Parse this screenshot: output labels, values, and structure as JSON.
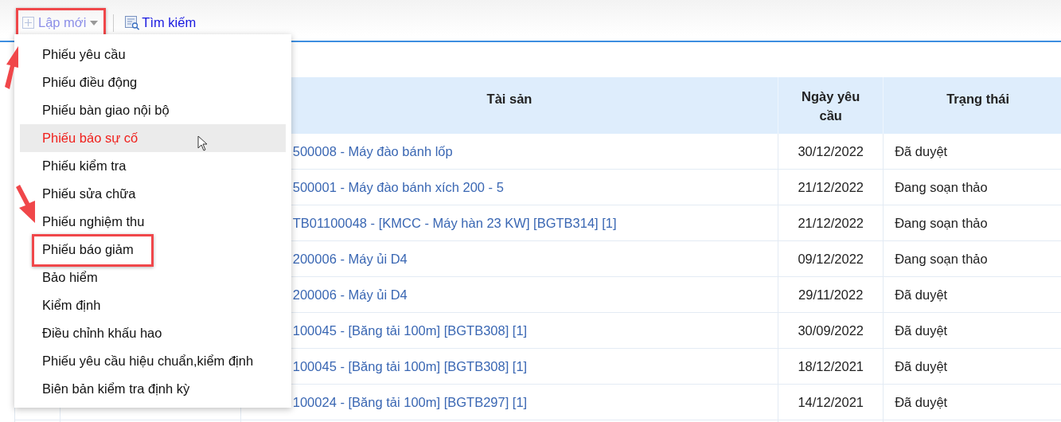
{
  "toolbar": {
    "new_button": {
      "label": "Lập mới",
      "callout": true
    },
    "search_button": {
      "label": "Tìm kiếm"
    }
  },
  "menu": [
    {
      "label": "Phiếu yêu cầu",
      "selected": false,
      "callout": false
    },
    {
      "label": "Phiếu điều động",
      "selected": false,
      "callout": false
    },
    {
      "label": "Phiếu bàn giao nội bộ",
      "selected": false,
      "callout": false
    },
    {
      "label": "Phiếu báo sự cố",
      "selected": true,
      "callout": false
    },
    {
      "label": "Phiếu kiểm tra",
      "selected": false,
      "callout": false
    },
    {
      "label": "Phiếu sửa chữa",
      "selected": false,
      "callout": false
    },
    {
      "label": "Phiếu nghiệm thu",
      "selected": false,
      "callout": false
    },
    {
      "label": "Phiếu báo giảm",
      "selected": false,
      "callout": true
    },
    {
      "label": "Bảo hiểm",
      "selected": false,
      "callout": false
    },
    {
      "label": "Kiểm định",
      "selected": false,
      "callout": false
    },
    {
      "label": "Điều chỉnh khấu hao",
      "selected": false,
      "callout": false
    },
    {
      "label": "Phiếu yêu cầu hiệu chuẩn,kiểm định",
      "selected": false,
      "callout": false
    },
    {
      "label": "Biên bản kiểm tra định kỳ",
      "selected": false,
      "callout": false
    }
  ],
  "table": {
    "columns": [
      "Tài sản",
      "Ngày yêu cầu",
      "Trạng thái"
    ],
    "rows": [
      {
        "asset": "500008 - Máy đào bánh lốp",
        "date": "30/12/2022",
        "status": "Đã duyệt"
      },
      {
        "asset": "500001 - Máy đào bánh xích 200 - 5",
        "date": "21/12/2022",
        "status": "Đang soạn thảo"
      },
      {
        "asset": "TB01100048 - [KMCC - Máy hàn 23 KW] [BGTB314] [1]",
        "date": "21/12/2022",
        "status": "Đang soạn thảo"
      },
      {
        "asset": "200006 - Máy ủi D4",
        "date": "09/12/2022",
        "status": "Đang soạn thảo"
      },
      {
        "asset": "200006 - Máy ủi D4",
        "date": "29/11/2022",
        "status": "Đã duyệt"
      },
      {
        "asset": "100045 - [Băng tải 100m] [BGTB308] [1]",
        "date": "30/09/2022",
        "status": "Đã duyệt"
      },
      {
        "asset": "100045 - [Băng tải 100m] [BGTB308] [1]",
        "date": "18/12/2021",
        "status": "Đã duyệt"
      },
      {
        "asset": "100024 - [Băng tải 100m] [BGTB297] [1]",
        "date": "14/12/2021",
        "status": "Đã duyệt"
      }
    ]
  }
}
